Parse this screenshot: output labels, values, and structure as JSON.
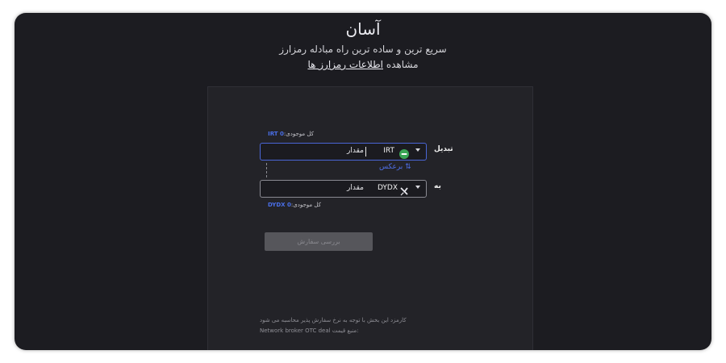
{
  "header": {
    "title": "آسان",
    "tagline": "سریع ترین و ساده ترین راه مبادله رمزارز",
    "view_prefix": "مشاهده",
    "view_link": "اطلاعات رمزارز ها"
  },
  "exchange": {
    "from": {
      "balance_label": "کل موجودی:",
      "balance_value": "IRT 0",
      "row_label": "تبدیل",
      "coin": "IRT",
      "coin_icon": "toman-icon",
      "coin_icon_color": "#3aa655",
      "amount_placeholder": "مقدار"
    },
    "swap_label": "برعکس",
    "to": {
      "row_label": "به",
      "coin": "DYDX",
      "coin_icon": "dydx-icon",
      "amount_placeholder": "مقدار",
      "balance_label": "کل موجودی:",
      "balance_value": "DYDX 0"
    },
    "submit_label": "بررسی سفارش"
  },
  "footer": {
    "fee_note": "کارمزد این بخش با توجه به نرخ سفارش پذیر محاسبه می شود",
    "price_source_label": "منبع قیمت:",
    "price_source_value": "Network broker OTC deal"
  },
  "colors": {
    "accent": "#4a6fe8",
    "background": "#1c1c21",
    "card": "#232328"
  }
}
